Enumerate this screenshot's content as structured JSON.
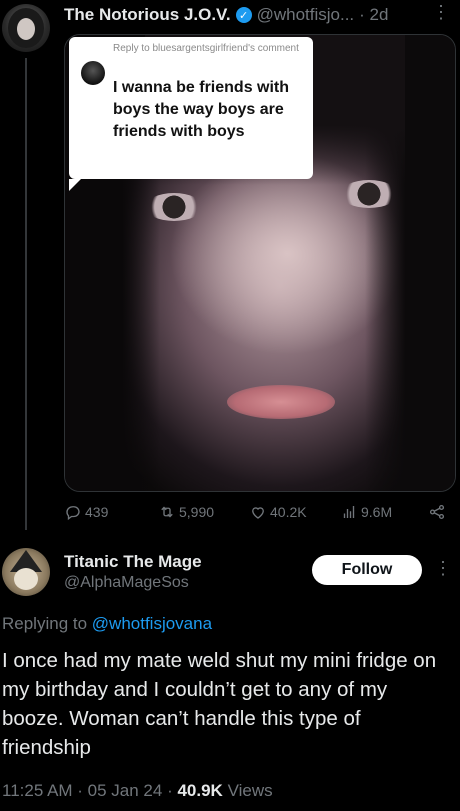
{
  "tweet": {
    "author_name": "The Notorious J.O.V.",
    "author_handle": "@whotfisjo...",
    "time": "· 2d",
    "more": "⋮",
    "media": {
      "reply_label": "Reply to bluesargentsgirlfriend's comment",
      "reply_text": "I wanna be friends with boys the way boys are friends with boys"
    },
    "actions": {
      "replies": "439",
      "retweets": "5,990",
      "likes": "40.2K",
      "views": "9.6M"
    }
  },
  "reply": {
    "author_name": "Titanic The Mage",
    "author_handle": "@AlphaMageSos",
    "follow_label": "Follow",
    "more": "⋮",
    "replying_prefix": "Replying to ",
    "replying_mention": "@whotfisjovana",
    "text": "I once had my mate weld shut my mini fridge on my birthday and I couldn’t get to any of my booze. Woman can’t handle this type of friendship",
    "timestamp": "11:25 AM · 05 Jan 24 · ",
    "views_count": "40.9K",
    "views_label": " Views"
  },
  "colors": {
    "accent": "#1d9bf0",
    "muted": "#71767b",
    "text": "#e7e9ea",
    "background": "#000000"
  },
  "icons": [
    "verified-icon",
    "reply-icon",
    "retweet-icon",
    "like-icon",
    "views-icon",
    "share-icon",
    "more-icon"
  ]
}
